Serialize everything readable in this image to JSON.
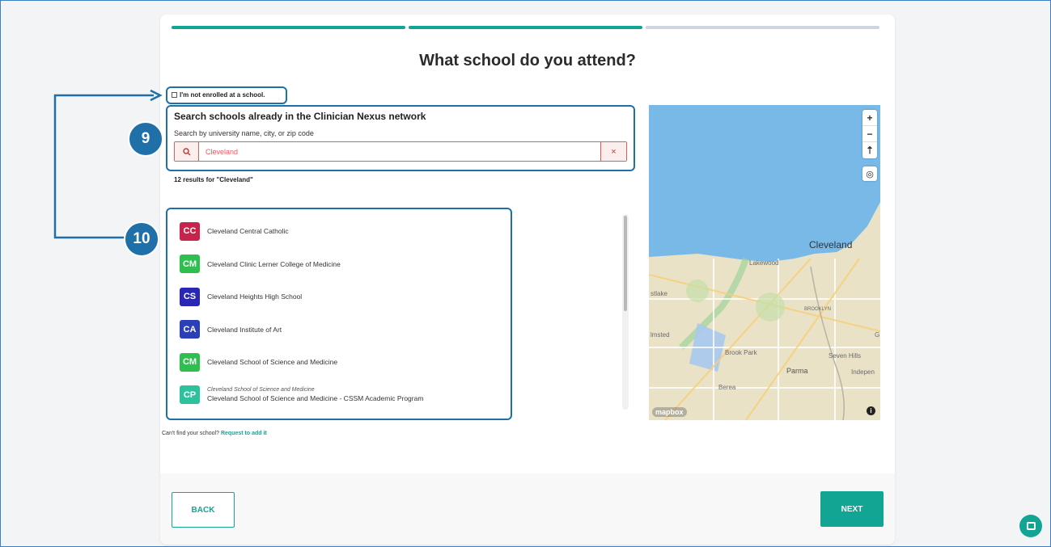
{
  "page": {
    "title": "What school do you attend?",
    "progress_steps": [
      {
        "done": true
      },
      {
        "done": true
      },
      {
        "done": false
      }
    ]
  },
  "enrollment": {
    "label": "I'm not enrolled at a school.",
    "checked": false
  },
  "search": {
    "heading": "Search schools already in the Clinician Nexus network",
    "subheading": "Search by university name, city, or zip code",
    "value": "Cleveland",
    "clear_icon": "×",
    "results_label": "12 results for \"Cleveland\""
  },
  "results": [
    {
      "badge": "CC",
      "color": "#c8234a",
      "name": "Cleveland Central Catholic",
      "parent": ""
    },
    {
      "badge": "CM",
      "color": "#2fbf4f",
      "name": "Cleveland Clinic Lerner College of Medicine",
      "parent": ""
    },
    {
      "badge": "CS",
      "color": "#2a27b5",
      "name": "Cleveland Heights High School",
      "parent": ""
    },
    {
      "badge": "CA",
      "color": "#2b3fb8",
      "name": "Cleveland Institute of Art",
      "parent": ""
    },
    {
      "badge": "CM",
      "color": "#2fbf4f",
      "name": "Cleveland School of Science and Medicine",
      "parent": ""
    },
    {
      "badge": "CP",
      "color": "#2cc39c",
      "name": "Cleveland School of Science and Medicine - CSSM Academic Program",
      "parent": "Cleveland School of Science and Medicine"
    }
  ],
  "cant_find": {
    "text": "Can't find your school?",
    "link": "Request to add it"
  },
  "map": {
    "zoom_in": "+",
    "zoom_out": "−",
    "compass": "⇡",
    "geolocate": "◎",
    "attribution": "mapbox",
    "info": "i",
    "labels": {
      "cleveland": "Cleveland",
      "lakewood": "Lakewood",
      "westlake": "stlake",
      "brooklyn": "BROOKLYN",
      "olmsted": "lmsted",
      "brookpark": "Brook Park",
      "sevenhills": "Seven Hills",
      "parma": "Parma",
      "independence": "Indepen",
      "berea": "Berea",
      "g": "G"
    },
    "colors": {
      "water": "#79b9e8",
      "land": "#e9e2c7"
    }
  },
  "footer": {
    "back_label": "BACK",
    "next_label": "NEXT"
  },
  "annotations": {
    "step9": "9",
    "step10": "10"
  },
  "colors": {
    "accent": "#12a593",
    "annotation": "#1f6fa8",
    "error": "#e35b5b"
  }
}
